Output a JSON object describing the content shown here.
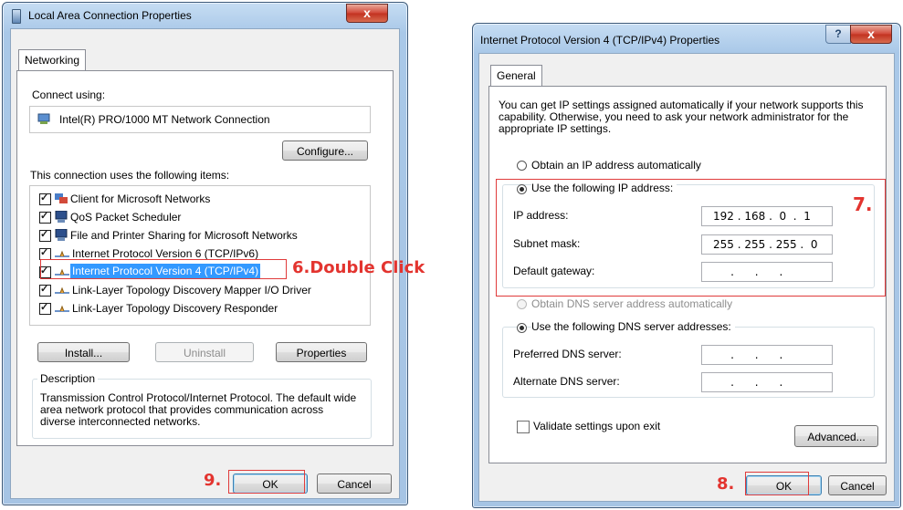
{
  "left_dialog": {
    "title": "Local Area Connection Properties",
    "close_glyph": "x",
    "tab": "Networking",
    "connect_using_label": "Connect using:",
    "adapter": "Intel(R) PRO/1000 MT Network Connection",
    "configure_button": "Configure...",
    "items_label": "This connection uses the following items:",
    "items": [
      {
        "label": "Client for Microsoft Networks",
        "icon": "network-client-icon",
        "checked": true
      },
      {
        "label": "QoS Packet Scheduler",
        "icon": "scheduler-icon",
        "checked": true
      },
      {
        "label": "File and Printer Sharing for Microsoft Networks",
        "icon": "file-printer-sharing-icon",
        "checked": true
      },
      {
        "label": "Internet Protocol Version 6 (TCP/IPv6)",
        "icon": "protocol-icon",
        "checked": true
      },
      {
        "label": "Internet Protocol Version 4 (TCP/IPv4)",
        "icon": "protocol-icon",
        "checked": true,
        "selected": true
      },
      {
        "label": "Link-Layer Topology Discovery Mapper I/O Driver",
        "icon": "protocol-icon",
        "checked": true
      },
      {
        "label": "Link-Layer Topology Discovery Responder",
        "icon": "protocol-icon",
        "checked": true
      }
    ],
    "install_button": "Install...",
    "uninstall_button": "Uninstall",
    "properties_button": "Properties",
    "description_label": "Description",
    "description_text": "Transmission Control Protocol/Internet Protocol. The default wide area network protocol that provides communication across diverse interconnected networks.",
    "ok_button": "OK",
    "cancel_button": "Cancel"
  },
  "right_dialog": {
    "title": "Internet Protocol Version 4 (TCP/IPv4) Properties",
    "help_glyph": "?",
    "close_glyph": "x",
    "tab": "General",
    "intro_text": "You can get IP settings assigned automatically if your network supports this capability. Otherwise, you need to ask your network administrator for the appropriate IP settings.",
    "radio_auto_ip": "Obtain an IP address automatically",
    "radio_manual_ip": "Use the following IP address:",
    "ip_address_label": "IP address:",
    "ip_address_value": "192 . 168 .  0  .  1",
    "subnet_mask_label": "Subnet mask:",
    "subnet_mask_value": "255 . 255 . 255 .  0",
    "gateway_label": "Default gateway:",
    "gateway_value": "     .      .      .",
    "radio_auto_dns": "Obtain DNS server address automatically",
    "radio_manual_dns": "Use the following DNS server addresses:",
    "preferred_dns_label": "Preferred DNS server:",
    "preferred_dns_value": "     .      .      .",
    "alternate_dns_label": "Alternate DNS server:",
    "alternate_dns_value": "     .      .      .",
    "validate_label": "Validate settings upon exit",
    "advanced_button": "Advanced...",
    "ok_button": "OK",
    "cancel_button": "Cancel"
  },
  "annotations": {
    "step6": "6.Double Click",
    "step7": "7.",
    "step8": "8.",
    "step9": "9."
  },
  "colors": {
    "annotation_red": "#e3342f",
    "title_bar_blue": "#a9c8e8",
    "selection_blue": "#3399ff"
  }
}
